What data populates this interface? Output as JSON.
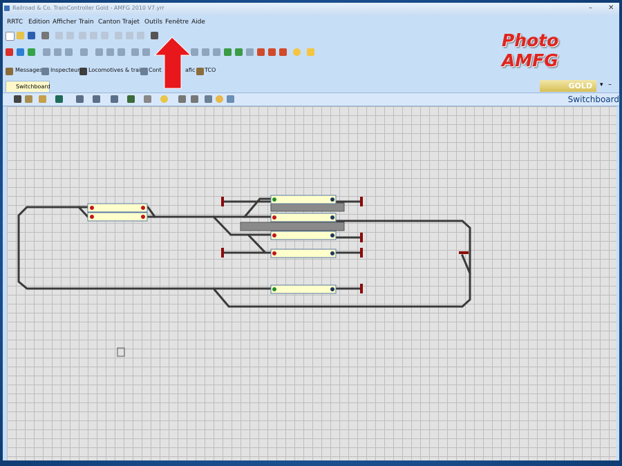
{
  "window": {
    "title": "Railroad & Co. TrainController Gold - AMFG 2010 V7.yrr"
  },
  "menu": [
    "RRTC",
    "Edition",
    "Afficher",
    "Train",
    "Canton",
    "Trajet",
    "Outils",
    "Fenêtre",
    "Aide"
  ],
  "logo": {
    "text": "Photo AMFG"
  },
  "views": {
    "messages": "Messages",
    "inspecteur": "Inspecteur",
    "locomotives": "Locomotives & trains",
    "contrôle": "Cont",
    "trafic": "afic",
    "tco": "TCO"
  },
  "tab": {
    "label": "Switchboard"
  },
  "brand": {
    "label": "GOLD"
  },
  "switchboard": {
    "title": "Switchboard"
  },
  "colors": {
    "arrow": "#e8171b",
    "track": "#3a3a3a",
    "block": "#ffffcc",
    "buffer": "#8b0a0a"
  }
}
